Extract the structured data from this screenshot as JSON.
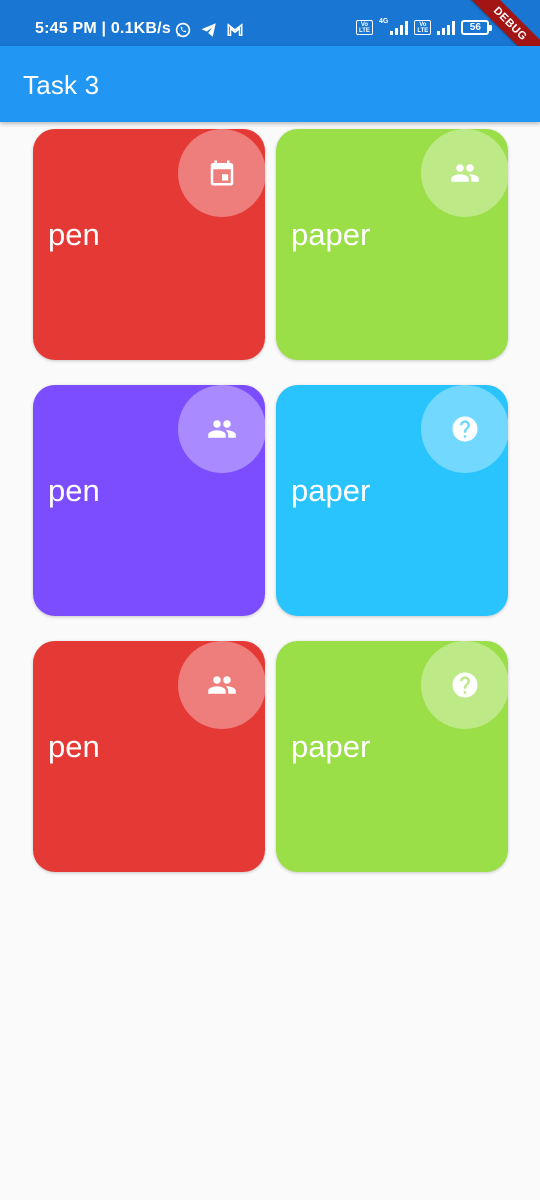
{
  "status_bar": {
    "time": "5:45 PM | 0.1KB/s",
    "network_type": "4G",
    "battery_level": "56",
    "debug_banner": "DEBUG"
  },
  "app_bar": {
    "title": "Task 3"
  },
  "cards": [
    {
      "label": "pen",
      "color": "#e53935",
      "icon": "calendar-icon"
    },
    {
      "label": "paper",
      "color": "#9ade48",
      "icon": "people-icon"
    },
    {
      "label": "pen",
      "color": "#7c4dff",
      "icon": "people-icon"
    },
    {
      "label": "paper",
      "color": "#29c3fd",
      "icon": "help-icon"
    },
    {
      "label": "pen",
      "color": "#e53935",
      "icon": "people-icon"
    },
    {
      "label": "paper",
      "color": "#9ade48",
      "icon": "help-icon"
    }
  ]
}
